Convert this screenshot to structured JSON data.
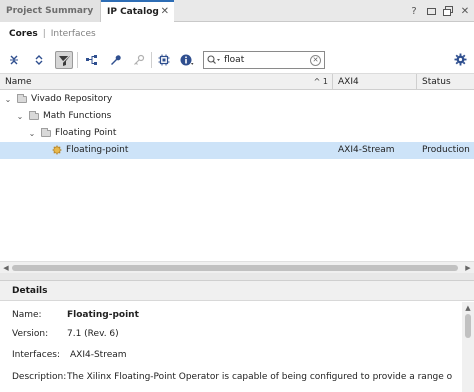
{
  "tabs": [
    {
      "label": "Project Summary",
      "active": false
    },
    {
      "label": "IP Catalog",
      "active": true
    }
  ],
  "window_controls": {
    "help": "?",
    "restore": "▭",
    "maximize": "⧉",
    "close": "✕"
  },
  "subtabs": {
    "cores": "Cores",
    "separator": "|",
    "interfaces": "Interfaces"
  },
  "toolbar": {
    "search_value": "float",
    "search_placeholder": "",
    "icons": [
      "collapse-all-icon",
      "expand-all-icon",
      "filter-icon",
      "hierarchy-icon",
      "wrench-icon",
      "key-icon",
      "chip-icon",
      "info-icon",
      "search-icon",
      "gear-icon"
    ]
  },
  "table": {
    "headers": {
      "name": "Name",
      "axi4": "AXI4",
      "status": "Status",
      "sort": "^ 1"
    },
    "rows": [
      {
        "label": "Vivado Repository",
        "axi4": "",
        "status": ""
      },
      {
        "label": "Math Functions",
        "axi4": "",
        "status": ""
      },
      {
        "label": "Floating Point",
        "axi4": "",
        "status": ""
      },
      {
        "label": "Floating-point",
        "axi4": "AXI4-Stream",
        "status": "Production"
      }
    ]
  },
  "details": {
    "title": "Details",
    "name_label": "Name:",
    "name_value": "Floating-point",
    "version_label": "Version:",
    "version_value": "7.1 (Rev. 6)",
    "interfaces_label": "Interfaces:",
    "interfaces_value": "AXI4-Stream",
    "description_label": "Description:",
    "description_value": "The Xilinx Floating-Point Operator is capable of being configured to provide a range of floating-point"
  },
  "colors": {
    "accent": "#2d6db5",
    "selected_row": "#cde3f8",
    "ip_icon": "#e8b84a"
  }
}
